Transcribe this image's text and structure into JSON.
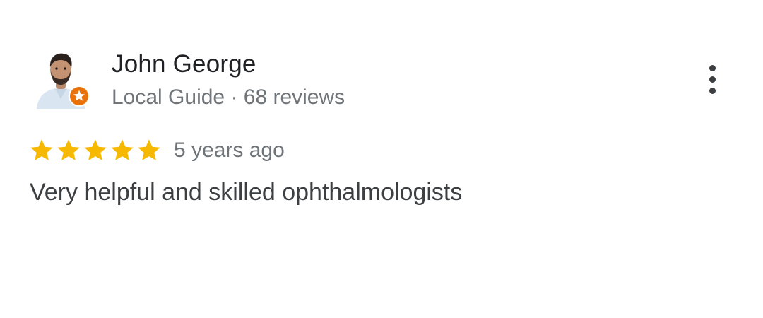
{
  "reviewer": {
    "name": "John George",
    "badge_icon": "local-guide-badge-icon",
    "meta": "Local Guide · 68 reviews"
  },
  "review": {
    "rating": 5,
    "max_rating": 5,
    "time": "5 years ago",
    "text": "Very helpful and skilled ophthalmologists"
  },
  "actions": {
    "more_icon": "more-vert-icon"
  },
  "colors": {
    "star": "#F6B800",
    "badge": "#E8710A",
    "name": "#202124",
    "secondary": "#70757A",
    "body_text": "#3C4043"
  }
}
